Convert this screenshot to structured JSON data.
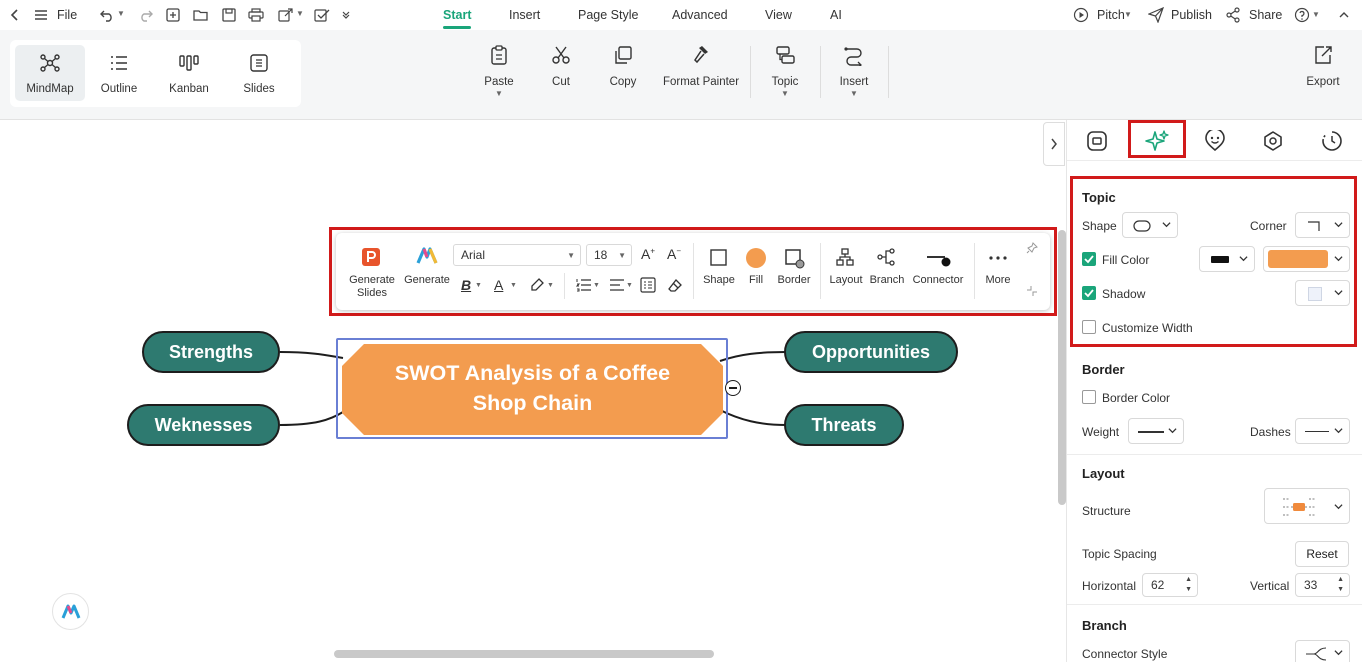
{
  "topbar": {
    "file_label": "File",
    "menu_tabs": [
      "Start",
      "Insert",
      "Page Style",
      "Advanced",
      "View",
      "AI"
    ],
    "pitch_label": "Pitch",
    "publish_label": "Publish",
    "share_label": "Share"
  },
  "ribbon": {
    "views": [
      "MindMap",
      "Outline",
      "Kanban",
      "Slides"
    ],
    "paste": "Paste",
    "cut": "Cut",
    "copy": "Copy",
    "format_painter": "Format Painter",
    "topic": "Topic",
    "insert": "Insert",
    "export": "Export"
  },
  "mindmap": {
    "central_line1": "SWOT Analysis of a Coffee",
    "central_line2": "Shop Chain",
    "central_color": "#f39c4f",
    "branch_color": "#2e7a70",
    "nodes": {
      "strengths": "Strengths",
      "weaknesses": "Weknesses",
      "opportunities": "Opportunities",
      "threats": "Threats"
    }
  },
  "floating_toolbar": {
    "generate_slides_1": "Generate",
    "generate_slides_2": "Slides",
    "generate": "Generate",
    "font": "Arial",
    "font_size": "18",
    "shape": "Shape",
    "fill": "Fill",
    "border": "Border",
    "layout": "Layout",
    "branch": "Branch",
    "connector": "Connector",
    "more": "More"
  },
  "panel": {
    "topic": {
      "title": "Topic",
      "shape_label": "Shape",
      "corner_label": "Corner",
      "fill_color_label": "Fill Color",
      "fill_color_checked": true,
      "fill_swatch": "#f39c4f",
      "shadow_label": "Shadow",
      "shadow_checked": true,
      "customize_width_label": "Customize Width",
      "customize_width_checked": false
    },
    "border": {
      "title": "Border",
      "border_color_label": "Border Color",
      "weight_label": "Weight",
      "dashes_label": "Dashes"
    },
    "layout": {
      "title": "Layout",
      "structure_label": "Structure",
      "topic_spacing_label": "Topic Spacing",
      "reset_label": "Reset",
      "horizontal_label": "Horizontal",
      "horizontal_value": "62",
      "vertical_label": "Vertical",
      "vertical_value": "33"
    },
    "branch": {
      "title": "Branch",
      "connector_style_label": "Connector Style"
    }
  },
  "colors": {
    "accent": "#1aa57a",
    "highlight": "#d11a1a"
  }
}
